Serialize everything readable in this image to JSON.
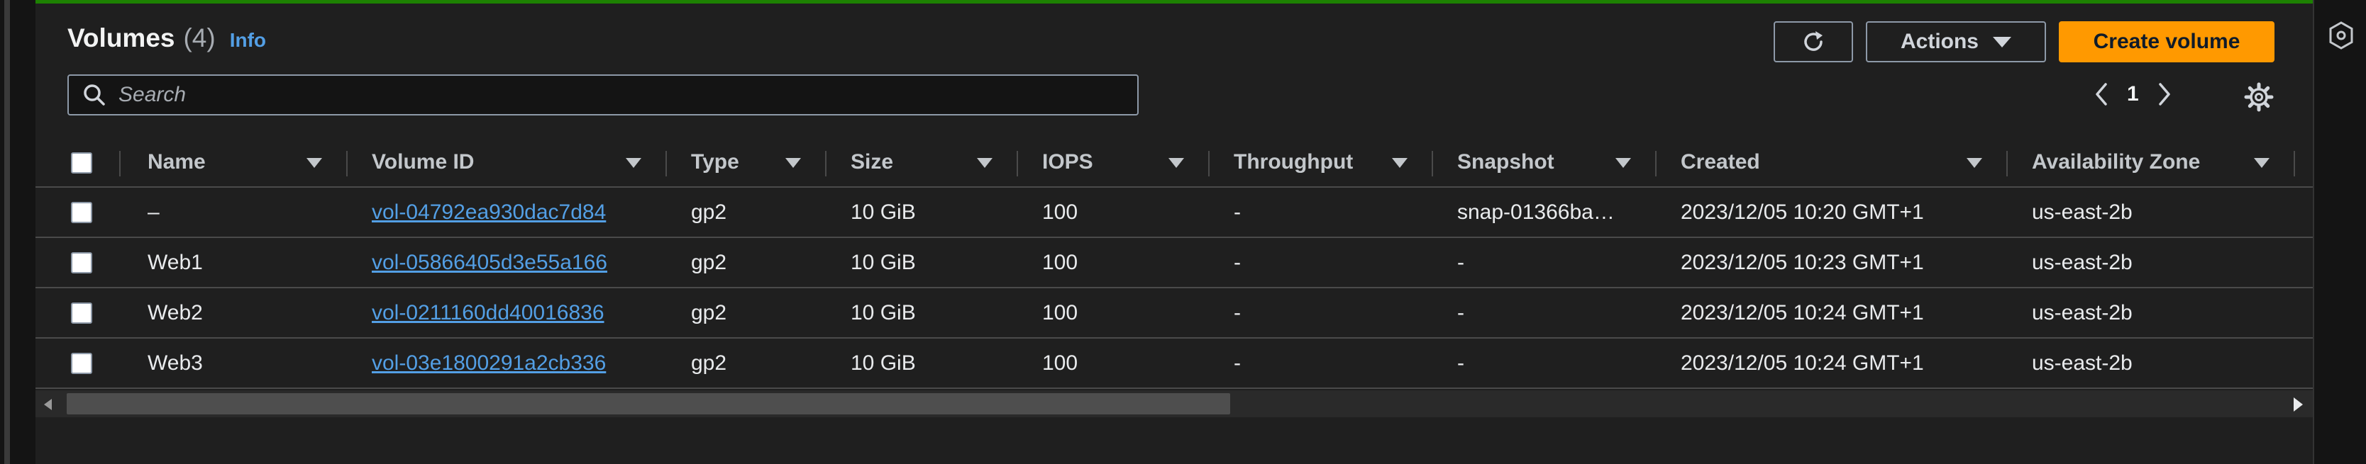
{
  "header": {
    "title": "Volumes",
    "count": "(4)",
    "info_label": "Info"
  },
  "toolbar": {
    "refresh_icon": "refresh-icon",
    "actions_label": "Actions",
    "create_label": "Create volume"
  },
  "search": {
    "placeholder": "Search",
    "value": ""
  },
  "pagination": {
    "current_page": "1"
  },
  "table": {
    "columns": [
      "Name",
      "Volume ID",
      "Type",
      "Size",
      "IOPS",
      "Throughput",
      "Snapshot",
      "Created",
      "Availability Zone"
    ],
    "rows": [
      {
        "name": "–",
        "volume_id": "vol-04792ea930dac7d84",
        "type": "gp2",
        "size": "10 GiB",
        "iops": "100",
        "throughput": "-",
        "snapshot": "snap-01366ba…",
        "created": "2023/12/05 10:20 GMT+1",
        "az": "us-east-2b"
      },
      {
        "name": "Web1",
        "volume_id": "vol-05866405d3e55a166",
        "type": "gp2",
        "size": "10 GiB",
        "iops": "100",
        "throughput": "-",
        "snapshot": "-",
        "created": "2023/12/05 10:23 GMT+1",
        "az": "us-east-2b"
      },
      {
        "name": "Web2",
        "volume_id": "vol-0211160dd40016836",
        "type": "gp2",
        "size": "10 GiB",
        "iops": "100",
        "throughput": "-",
        "snapshot": "-",
        "created": "2023/12/05 10:24 GMT+1",
        "az": "us-east-2b"
      },
      {
        "name": "Web3",
        "volume_id": "vol-03e1800291a2cb336",
        "type": "gp2",
        "size": "10 GiB",
        "iops": "100",
        "throughput": "-",
        "snapshot": "-",
        "created": "2023/12/05 10:24 GMT+1",
        "az": "us-east-2b"
      }
    ]
  },
  "colors": {
    "accent": "#ff9900",
    "link": "#539fe5",
    "success_bar": "#1d8102",
    "panel": "#1f1f1f"
  }
}
